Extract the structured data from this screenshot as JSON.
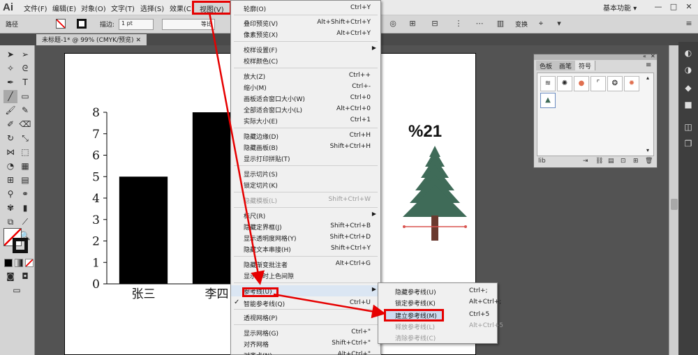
{
  "app": {
    "logo": "Ai"
  },
  "menubar": {
    "items": [
      "文件(F)",
      "编辑(E)",
      "对象(O)",
      "文字(T)",
      "选择(S)",
      "效果(C)",
      "视图(V)"
    ],
    "workspace": "基本功能",
    "workspace_arrow": "▾",
    "win_min": "—",
    "win_max": "□",
    "win_close": "✕"
  },
  "controlbar": {
    "mode_label": "路径",
    "stroke_label": "描边:",
    "stroke_value": "1 pt",
    "profile_value": "等比",
    "transform_label": "变换"
  },
  "document": {
    "tab_title": "未标题-1* @ 99% (CMYK/预览)",
    "tab_close": "✕"
  },
  "view_menu": {
    "items": [
      {
        "label": "轮廓(O)",
        "shortcut": "Ctrl+Y"
      },
      {
        "label": "叠印预览(V)",
        "shortcut": "Alt+Shift+Ctrl+Y"
      },
      {
        "label": "像素预览(X)",
        "shortcut": "Alt+Ctrl+Y"
      },
      {
        "label": "校样设置(F)",
        "shortcut": ""
      },
      {
        "label": "校样颜色(C)",
        "shortcut": ""
      },
      {
        "label": "放大(Z)",
        "shortcut": "Ctrl++"
      },
      {
        "label": "缩小(M)",
        "shortcut": "Ctrl+-"
      },
      {
        "label": "画板适合窗口大小(W)",
        "shortcut": "Ctrl+0"
      },
      {
        "label": "全部适合窗口大小(L)",
        "shortcut": "Alt+Ctrl+0"
      },
      {
        "label": "实际大小(E)",
        "shortcut": "Ctrl+1"
      },
      {
        "label": "隐藏边缘(D)",
        "shortcut": "Ctrl+H"
      },
      {
        "label": "隐藏画板(B)",
        "shortcut": "Shift+Ctrl+H"
      },
      {
        "label": "显示打印拼贴(T)",
        "shortcut": ""
      },
      {
        "label": "显示切片(S)",
        "shortcut": ""
      },
      {
        "label": "锁定切片(K)",
        "shortcut": ""
      },
      {
        "label": "隐藏模板(L)",
        "shortcut": "Shift+Ctrl+W"
      },
      {
        "label": "标尺(R)",
        "shortcut": ""
      },
      {
        "label": "隐藏定界框(J)",
        "shortcut": "Shift+Ctrl+B"
      },
      {
        "label": "显示透明度网格(Y)",
        "shortcut": "Shift+Ctrl+D"
      },
      {
        "label": "隐藏文本串接(H)",
        "shortcut": "Shift+Ctrl+Y"
      },
      {
        "label": "隐藏渐变批注者",
        "shortcut": "Alt+Ctrl+G"
      },
      {
        "label": "显示实时上色间隙",
        "shortcut": ""
      },
      {
        "label": "参考线(U)",
        "shortcut": ""
      },
      {
        "label": "智能参考线(Q)",
        "shortcut": "Ctrl+U"
      },
      {
        "label": "透视网格(P)",
        "shortcut": ""
      },
      {
        "label": "显示网格(G)",
        "shortcut": "Ctrl+\""
      },
      {
        "label": "对齐网格",
        "shortcut": "Shift+Ctrl+\""
      },
      {
        "label": "对齐点(N)",
        "shortcut": "Alt+Ctrl+\""
      }
    ],
    "check_mark": "✓",
    "submenu_arrow": "▶"
  },
  "guides_submenu": {
    "items": [
      {
        "label": "隐藏参考线(U)",
        "shortcut": "Ctrl+;"
      },
      {
        "label": "锁定参考线(K)",
        "shortcut": "Alt+Ctrl+;"
      },
      {
        "label": "建立参考线(M)",
        "shortcut": "Ctrl+5"
      },
      {
        "label": "释放参考线(L)",
        "shortcut": "Alt+Ctrl+5"
      },
      {
        "label": "清除参考线(C)",
        "shortcut": ""
      }
    ]
  },
  "symbols_panel": {
    "tabs": [
      "色板",
      "画笔",
      "符号"
    ],
    "active_tab": "符号",
    "footer_label": "lib",
    "panel_menu": "≡",
    "collapse": "«",
    "close": "✕",
    "scroll_up": "▴",
    "scroll_down": "▾"
  },
  "tree_label": "%21",
  "chart_data": {
    "type": "bar",
    "categories": [
      "张三",
      "李四"
    ],
    "values": [
      5,
      8
    ],
    "ylim": [
      0,
      8
    ],
    "yticks": [
      0,
      1,
      2,
      3,
      4,
      5,
      6,
      7,
      8
    ],
    "bar_color": "#000000",
    "grid": false
  },
  "colors": {
    "highlight": "#e60000",
    "tree": "#3f6b58",
    "guide": "#d9534f"
  }
}
